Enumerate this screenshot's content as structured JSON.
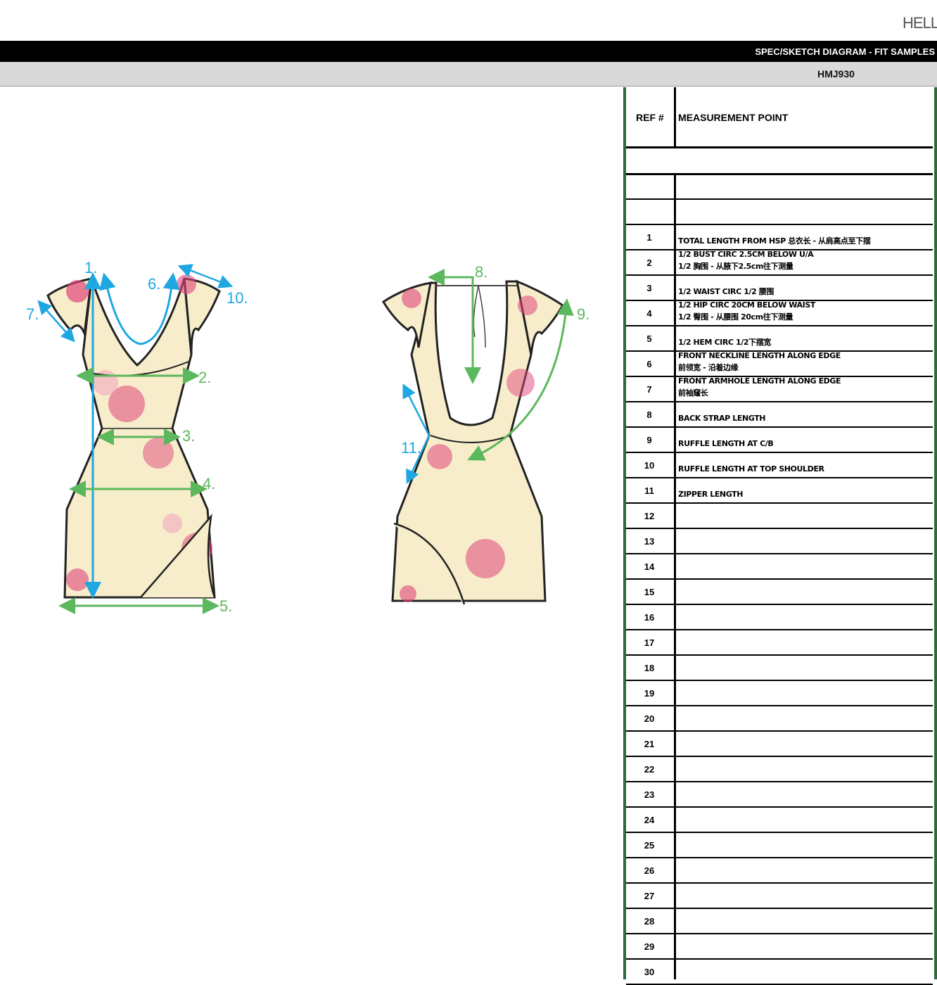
{
  "brand": "HELL",
  "header": {
    "title": "SPEC/SKETCH DIAGRAM - FIT SAMPLES",
    "style_no": "HMJ930"
  },
  "colors": {
    "table_border_green": "#2d6a3e",
    "measure_blue": "#1ea7e1",
    "measure_green": "#5cb85c",
    "garment_base": "#f7edcb",
    "flower_pink": "#e0457b"
  },
  "sketch": {
    "front_labels": [
      "1.",
      "2.",
      "3.",
      "4.",
      "5.",
      "6.",
      "7.",
      "10."
    ],
    "back_labels": [
      "8.",
      "9.",
      "11."
    ]
  },
  "table": {
    "col_ref": "REF #",
    "col_point": "MEASUREMENT POINT",
    "rows": [
      {
        "num": "1",
        "lines": [
          "TOTAL LENGTH FROM HSP 总衣长 - 从肩高点至下摆"
        ]
      },
      {
        "num": "2",
        "lines": [
          "1/2 BUST CIRC 2.5CM BELOW U/A",
          "1/2 胸围 - 从腋下2.5cm往下测量"
        ]
      },
      {
        "num": "3",
        "lines": [
          "1/2 WAIST CIRC  1/2 腰围"
        ]
      },
      {
        "num": "4",
        "lines": [
          "1/2 HIP CIRC 20CM BELOW WAIST",
          "1/2 臀围 - 从腰围 20cm往下测量"
        ]
      },
      {
        "num": "5",
        "lines": [
          "1/2 HEM CIRC 1/2下摆宽"
        ]
      },
      {
        "num": "6",
        "lines": [
          "FRONT NECKLINE LENGTH ALONG EDGE",
          "前领宽 - 沿着边缘"
        ]
      },
      {
        "num": "7",
        "lines": [
          "FRONT ARMHOLE LENGTH ALONG EDGE",
          "前袖窿长"
        ]
      },
      {
        "num": "8",
        "lines": [
          "BACK STRAP LENGTH"
        ]
      },
      {
        "num": "9",
        "lines": [
          "RUFFLE LENGTH AT C/B"
        ]
      },
      {
        "num": "10",
        "lines": [
          "RUFFLE LENGTH AT TOP SHOULDER"
        ]
      },
      {
        "num": "11",
        "lines": [
          "ZIPPER LENGTH"
        ]
      },
      {
        "num": "12",
        "lines": []
      },
      {
        "num": "13",
        "lines": []
      },
      {
        "num": "14",
        "lines": []
      },
      {
        "num": "15",
        "lines": []
      },
      {
        "num": "16",
        "lines": []
      },
      {
        "num": "17",
        "lines": []
      },
      {
        "num": "18",
        "lines": []
      },
      {
        "num": "19",
        "lines": []
      },
      {
        "num": "20",
        "lines": []
      },
      {
        "num": "21",
        "lines": []
      },
      {
        "num": "22",
        "lines": []
      },
      {
        "num": "23",
        "lines": []
      },
      {
        "num": "24",
        "lines": []
      },
      {
        "num": "25",
        "lines": []
      },
      {
        "num": "26",
        "lines": []
      },
      {
        "num": "27",
        "lines": []
      },
      {
        "num": "28",
        "lines": []
      },
      {
        "num": "29",
        "lines": []
      },
      {
        "num": "30",
        "lines": []
      }
    ]
  }
}
